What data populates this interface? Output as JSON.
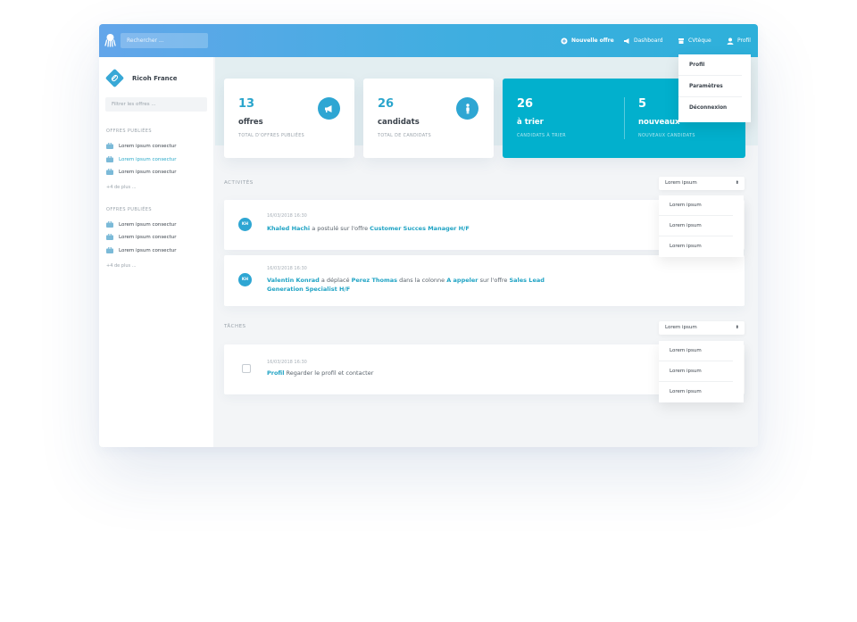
{
  "topbar": {
    "search_placeholder": "Rechercher ...",
    "nav_new": "Nouvelle offre",
    "nav_dashboard": "Dashboard",
    "nav_cv": "CVtèque",
    "nav_profil": "Profil",
    "accent": "#3faee0"
  },
  "profile_menu": [
    "Profil",
    "Paramètres",
    "Déconnexion"
  ],
  "sidebar": {
    "company": "Ricoh France",
    "filter_placeholder": "Filtrer les offres ...",
    "sections": [
      {
        "title": "OFFRES PUBLIÉES",
        "items": [
          "Lorem ipsum consectur",
          "Lorem ipsum consectur",
          "Lorem ipsum consectur"
        ],
        "more": "+4 de plus ..."
      },
      {
        "title": "OFFRES PUBLIÉES",
        "items": [
          "Lorem ipsum consectur",
          "Lorem ipsum consectur",
          "Lorem ipsum consectur"
        ],
        "more": "+4 de plus ..."
      }
    ]
  },
  "stats": [
    {
      "num": "13",
      "label": "offres",
      "sub": "TOTAL D'OFFRES PUBLIÉES",
      "icon": "megaphone-icon"
    },
    {
      "num": "26",
      "label": "candidats",
      "sub": "TOTAL DE CANDIDATS",
      "icon": "person-icon"
    },
    {
      "num": "26",
      "label": "à trier",
      "sub": "CANDIDATS À TRIER"
    },
    {
      "num": "5",
      "label": "nouveaux",
      "sub": "NOUVEAUX CANDIDATS"
    }
  ],
  "activities": {
    "title": "ACTIVITÉS",
    "select": "Lorem ipsum",
    "options": [
      "Lorem ipsum",
      "Lorem ipsum",
      "Lorem ipsum"
    ],
    "items": [
      {
        "avatar": "KH",
        "time": "16/03/2018 16:30",
        "name": "Khaled Hachi",
        "t1": " a postulé sur l'offre ",
        "offer": "Customer Succes Manager H/F"
      },
      {
        "avatar": "KH",
        "time": "16/03/2018 16:30",
        "name": "Valentin Konrad",
        "t1": " a déplacé ",
        "who": "Perez Thomas",
        "t2": " dans la colonne ",
        "col": "A appeler",
        "t3": " sur l'offre ",
        "offer": "Sales Lead Generation Specialist H/F"
      }
    ]
  },
  "tasks": {
    "title": "TÂCHES",
    "select": "Lorem ipsum",
    "options": [
      "Lorem ipsum",
      "Lorem ipsum",
      "Lorem ipsum"
    ],
    "items": [
      {
        "time": "16/03/2018 16:30",
        "link": "Profil",
        "text": " Regarder le profil et contacter"
      }
    ]
  }
}
